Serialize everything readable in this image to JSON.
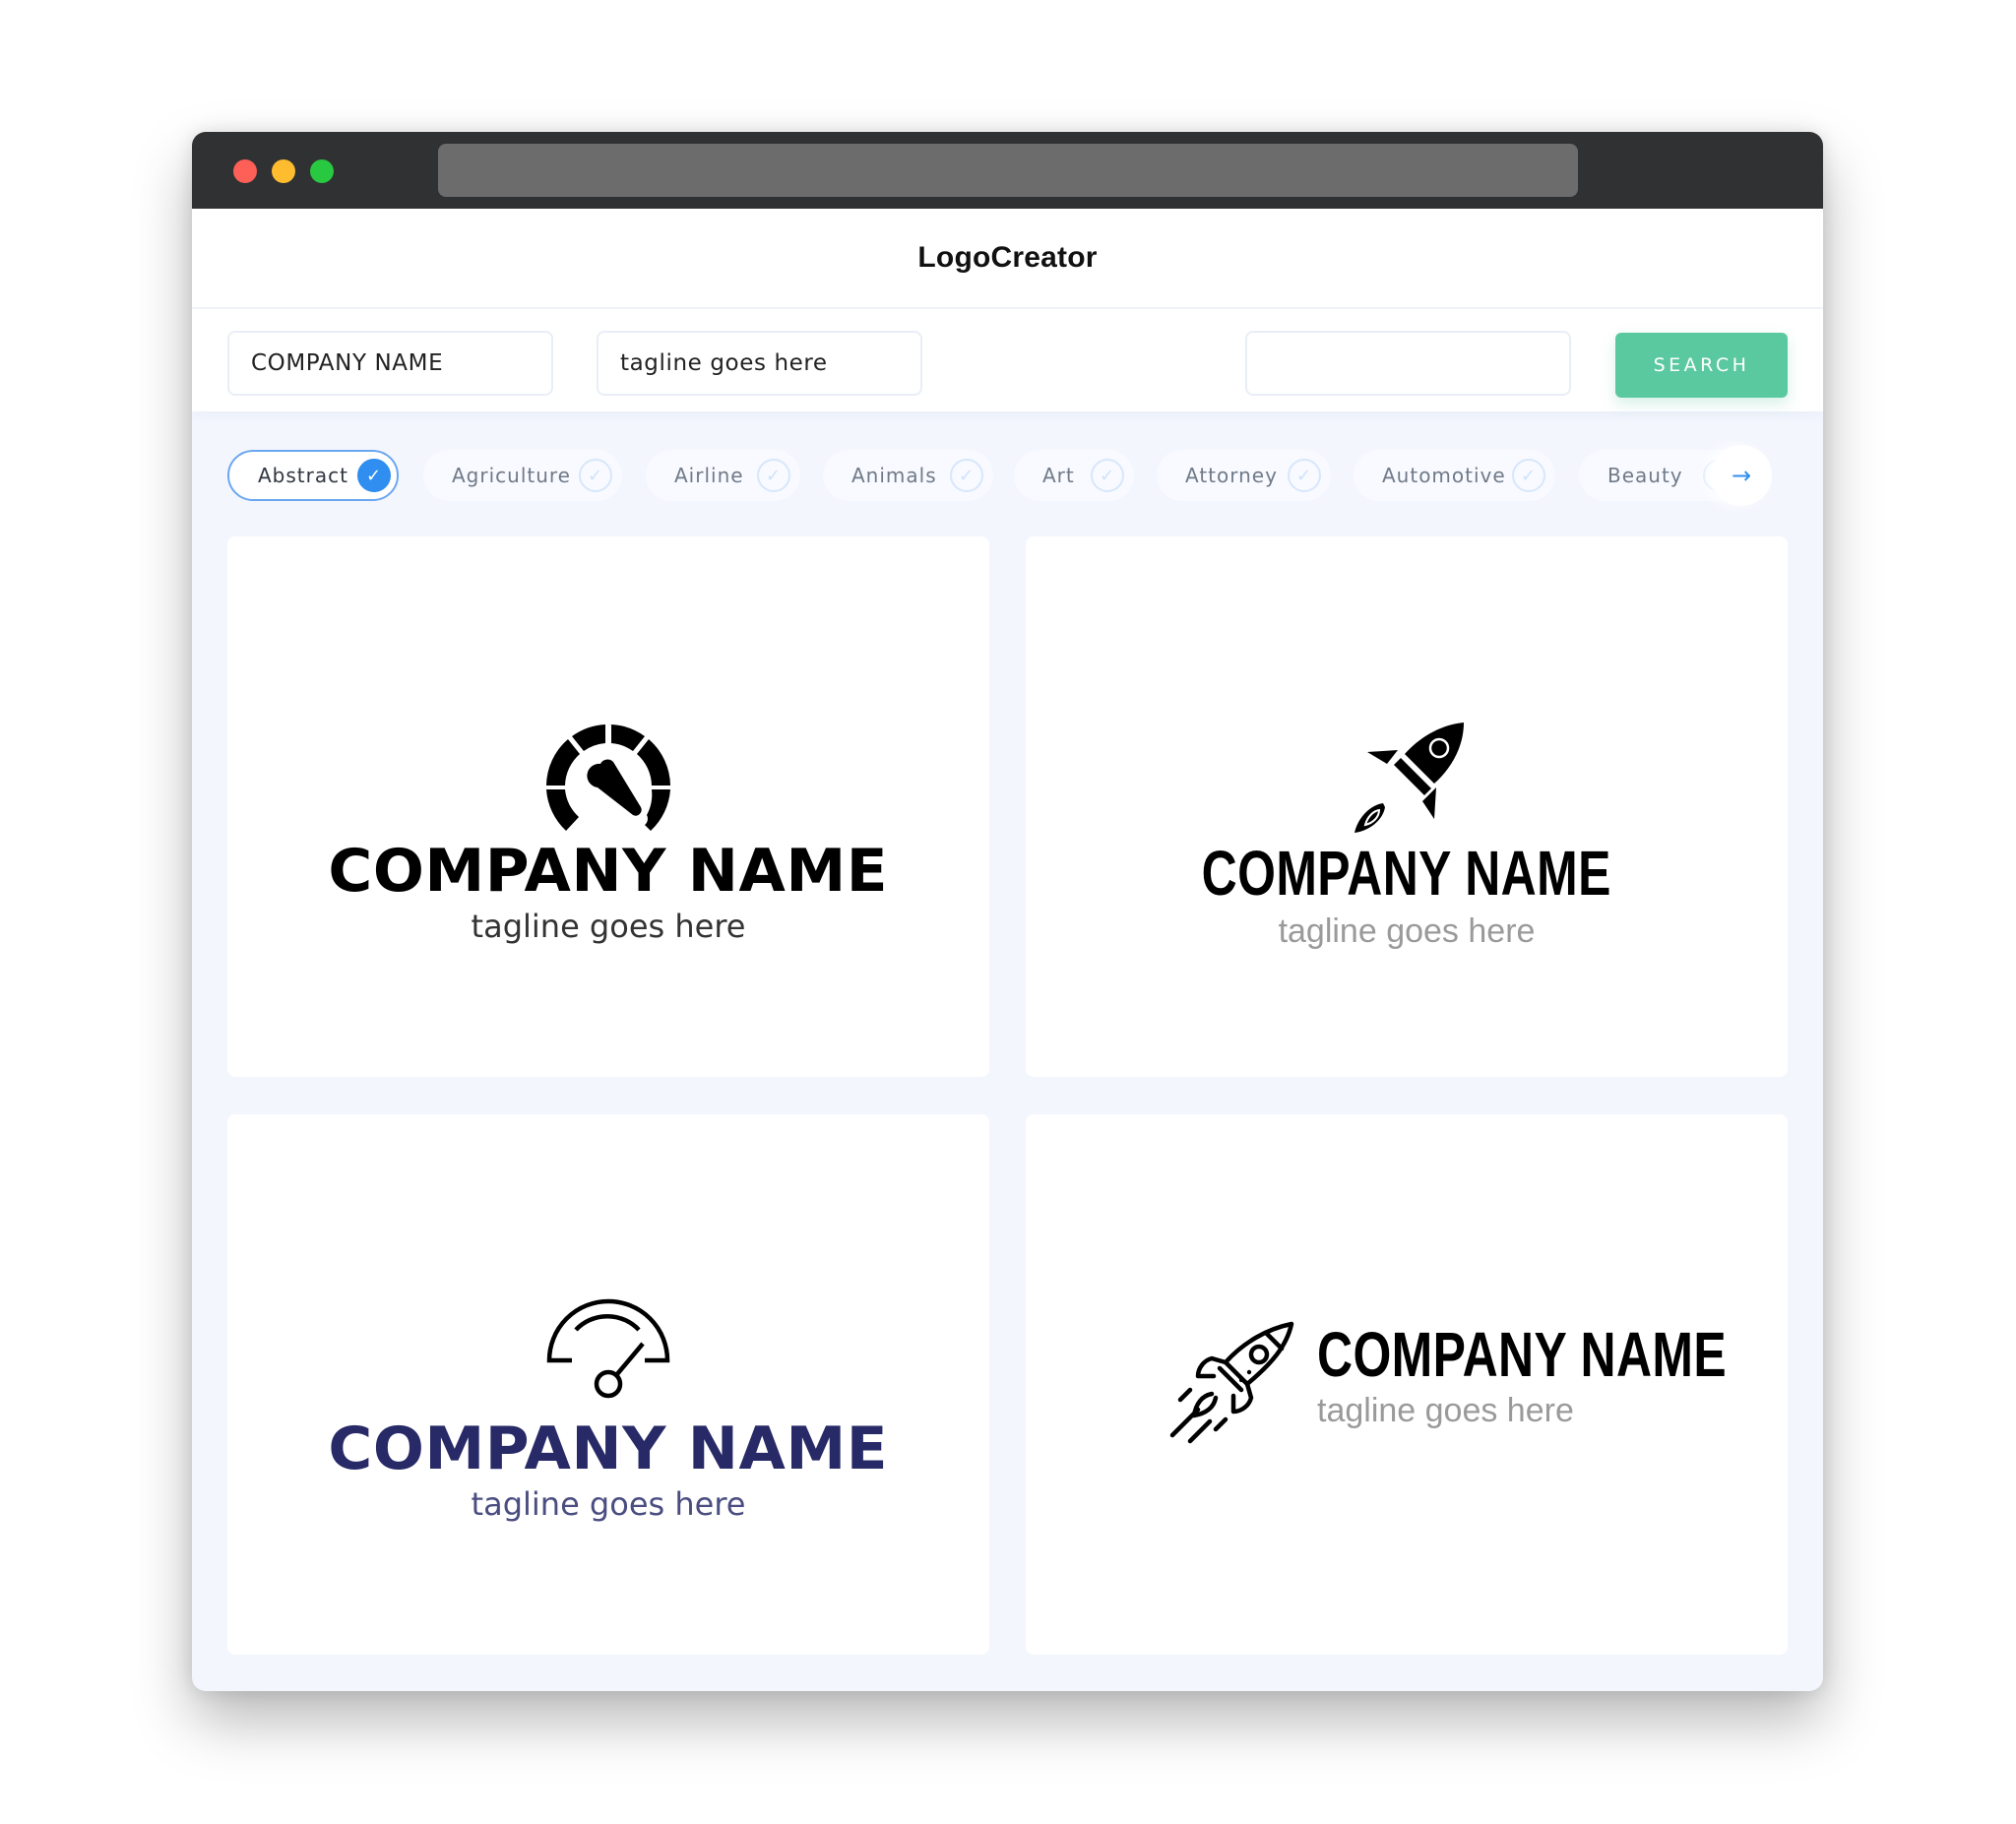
{
  "app": {
    "title": "LogoCreator"
  },
  "search": {
    "company_name_value": "COMPANY NAME",
    "tagline_value": "tagline goes here",
    "extra_value": "",
    "button_label": "SEARCH"
  },
  "categories": [
    {
      "label": "Abstract",
      "selected": true
    },
    {
      "label": "Agriculture",
      "selected": false
    },
    {
      "label": "Airline",
      "selected": false
    },
    {
      "label": "Animals",
      "selected": false
    },
    {
      "label": "Art",
      "selected": false
    },
    {
      "label": "Attorney",
      "selected": false
    },
    {
      "label": "Automotive",
      "selected": false
    },
    {
      "label": "Beauty",
      "selected": false
    }
  ],
  "icons": {
    "check": "✓",
    "next": "→"
  },
  "logos": [
    {
      "icon": "speedometer-solid-icon",
      "company": "COMPANY NAME",
      "tagline": "tagline goes here",
      "name_color": "#000000",
      "tagline_color": "#333333"
    },
    {
      "icon": "rocket-solid-icon",
      "company": "COMPANY NAME",
      "tagline": "tagline goes here",
      "name_color": "#000000",
      "tagline_color": "#9a9a9a"
    },
    {
      "icon": "speedometer-outline-icon",
      "company": "COMPANY NAME",
      "tagline": "tagline goes here",
      "name_color": "#272a66",
      "tagline_color": "#4a4d80"
    },
    {
      "icon": "rocket-outline-icon",
      "company": "COMPANY NAME",
      "tagline": "tagline goes here",
      "name_color": "#000000",
      "tagline_color": "#9a9a9a"
    }
  ],
  "colors": {
    "accent_blue": "#2f8ef0",
    "search_green": "#5bc9a0",
    "titlebar": "#303133",
    "navy": "#272a66"
  }
}
